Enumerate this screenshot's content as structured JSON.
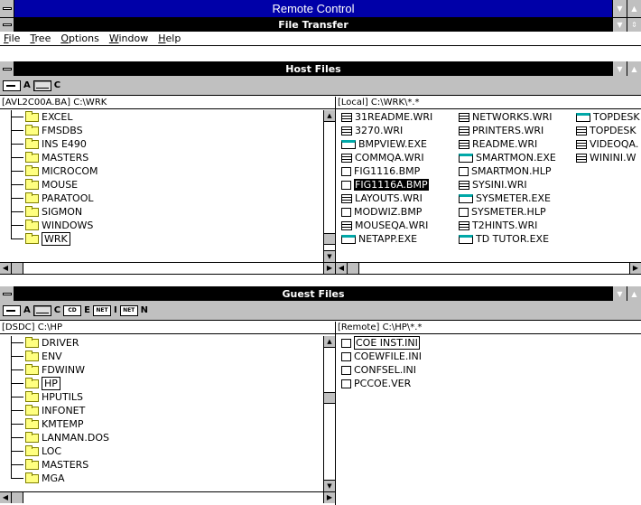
{
  "app_title": "Remote Control",
  "child_title": "File Transfer",
  "menu": [
    "File",
    "Tree",
    "Options",
    "Window",
    "Help"
  ],
  "host": {
    "title": "Host Files",
    "drives": [
      {
        "letter": "A",
        "icon": "floppy-drive-icon"
      },
      {
        "letter": "C",
        "icon": "hard-drive-icon",
        "selected": true
      }
    ],
    "tree_path": "[AVL2C00A.BA] C:\\WRK",
    "folders": [
      "EXCEL",
      "FMSDBS",
      "INS  E490",
      "MASTERS",
      "MICROCOM",
      "MOUSE",
      "PARATOOL",
      "SIGMON",
      "WINDOWS",
      "WRK"
    ],
    "selected_folder": "WRK",
    "file_path": "[Local] C:\\WRK\\*.*",
    "files": [
      [
        {
          "name": "31README.WRI",
          "icon": "doc"
        },
        {
          "name": "3270.WRI",
          "icon": "doc"
        },
        {
          "name": "BMPVIEW.EXE",
          "icon": "exe"
        },
        {
          "name": "COMMQA.WRI",
          "icon": "doc"
        },
        {
          "name": "FIG1116.BMP",
          "icon": "blank"
        },
        {
          "name": "FIG1116A.BMP",
          "icon": "blank",
          "highlight": true
        },
        {
          "name": "LAYOUTS.WRI",
          "icon": "doc"
        },
        {
          "name": "MODWIZ.BMP",
          "icon": "blank"
        },
        {
          "name": "MOUSEQA.WRI",
          "icon": "doc"
        },
        {
          "name": "NETAPP.EXE",
          "icon": "exe"
        }
      ],
      [
        {
          "name": "NETWORKS.WRI",
          "icon": "doc"
        },
        {
          "name": "PRINTERS.WRI",
          "icon": "doc"
        },
        {
          "name": "README.WRI",
          "icon": "doc"
        },
        {
          "name": "SMARTMON.EXE",
          "icon": "exe"
        },
        {
          "name": "SMARTMON.HLP",
          "icon": "blank"
        },
        {
          "name": "SYSINI.WRI",
          "icon": "doc"
        },
        {
          "name": "SYSMETER.EXE",
          "icon": "exe"
        },
        {
          "name": "SYSMETER.HLP",
          "icon": "blank"
        },
        {
          "name": "T2HINTS.WRI",
          "icon": "doc"
        },
        {
          "name": "TD  TUTOR.EXE",
          "icon": "exe"
        }
      ],
      [
        {
          "name": "TOPDESK",
          "icon": "exe"
        },
        {
          "name": "TOPDESK",
          "icon": "doc"
        },
        {
          "name": "VIDEOQA.",
          "icon": "doc"
        },
        {
          "name": "WININI.W",
          "icon": "doc"
        }
      ]
    ]
  },
  "guest": {
    "title": "Guest Files",
    "drives": [
      {
        "letter": "A",
        "icon": "floppy-drive-icon"
      },
      {
        "letter": "C",
        "icon": "hard-drive-icon",
        "selected": true
      },
      {
        "letter": "E",
        "icon": "cdrom-drive-icon",
        "tag": "CD"
      },
      {
        "letter": "I",
        "icon": "network-drive-icon",
        "tag": "NET"
      },
      {
        "letter": "N",
        "icon": "network-drive-icon",
        "tag": "NET"
      }
    ],
    "tree_path": "[DSDC] C:\\HP",
    "folders": [
      "DRIVER",
      "ENV",
      "FDWINW",
      "HP",
      "HPUTILS",
      "INFONET",
      "KMTEMP",
      "LANMAN.DOS",
      "LOC",
      "MASTERS",
      "MGA"
    ],
    "selected_folder": "HP",
    "file_path": "[Remote] C:\\HP\\*.*",
    "files": [
      [
        {
          "name": "COE  INST.INI",
          "icon": "blank",
          "boxed": true
        },
        {
          "name": "COEWFILE.INI",
          "icon": "blank"
        },
        {
          "name": "CONFSEL.INI",
          "icon": "blank"
        },
        {
          "name": "PCCOE.VER",
          "icon": "blank"
        }
      ]
    ]
  }
}
